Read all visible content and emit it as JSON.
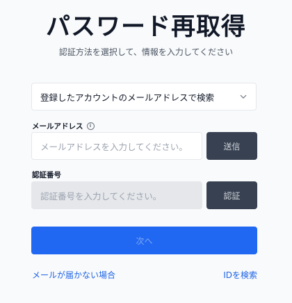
{
  "page": {
    "title": "パスワード再取得",
    "subtitle": "認証方法を選択して、情報を入力してください"
  },
  "method_select": {
    "selected": "登録したアカウントのメールアドレスで検索",
    "icon": "chevron-down-icon"
  },
  "email": {
    "label": "メールアドレス",
    "info_icon": "i",
    "placeholder": "メールアドレスを入力してください。",
    "send_label": "送信"
  },
  "code": {
    "label": "認証番号",
    "placeholder": "認証番号を入力してください。",
    "verify_label": "認証"
  },
  "next_label": "次へ",
  "links": {
    "no_mail": "メールが届かない場合",
    "find_id": "IDを検索"
  },
  "colors": {
    "primary": "#2067f2",
    "dark_button": "#374151",
    "link": "#1d64e6"
  }
}
